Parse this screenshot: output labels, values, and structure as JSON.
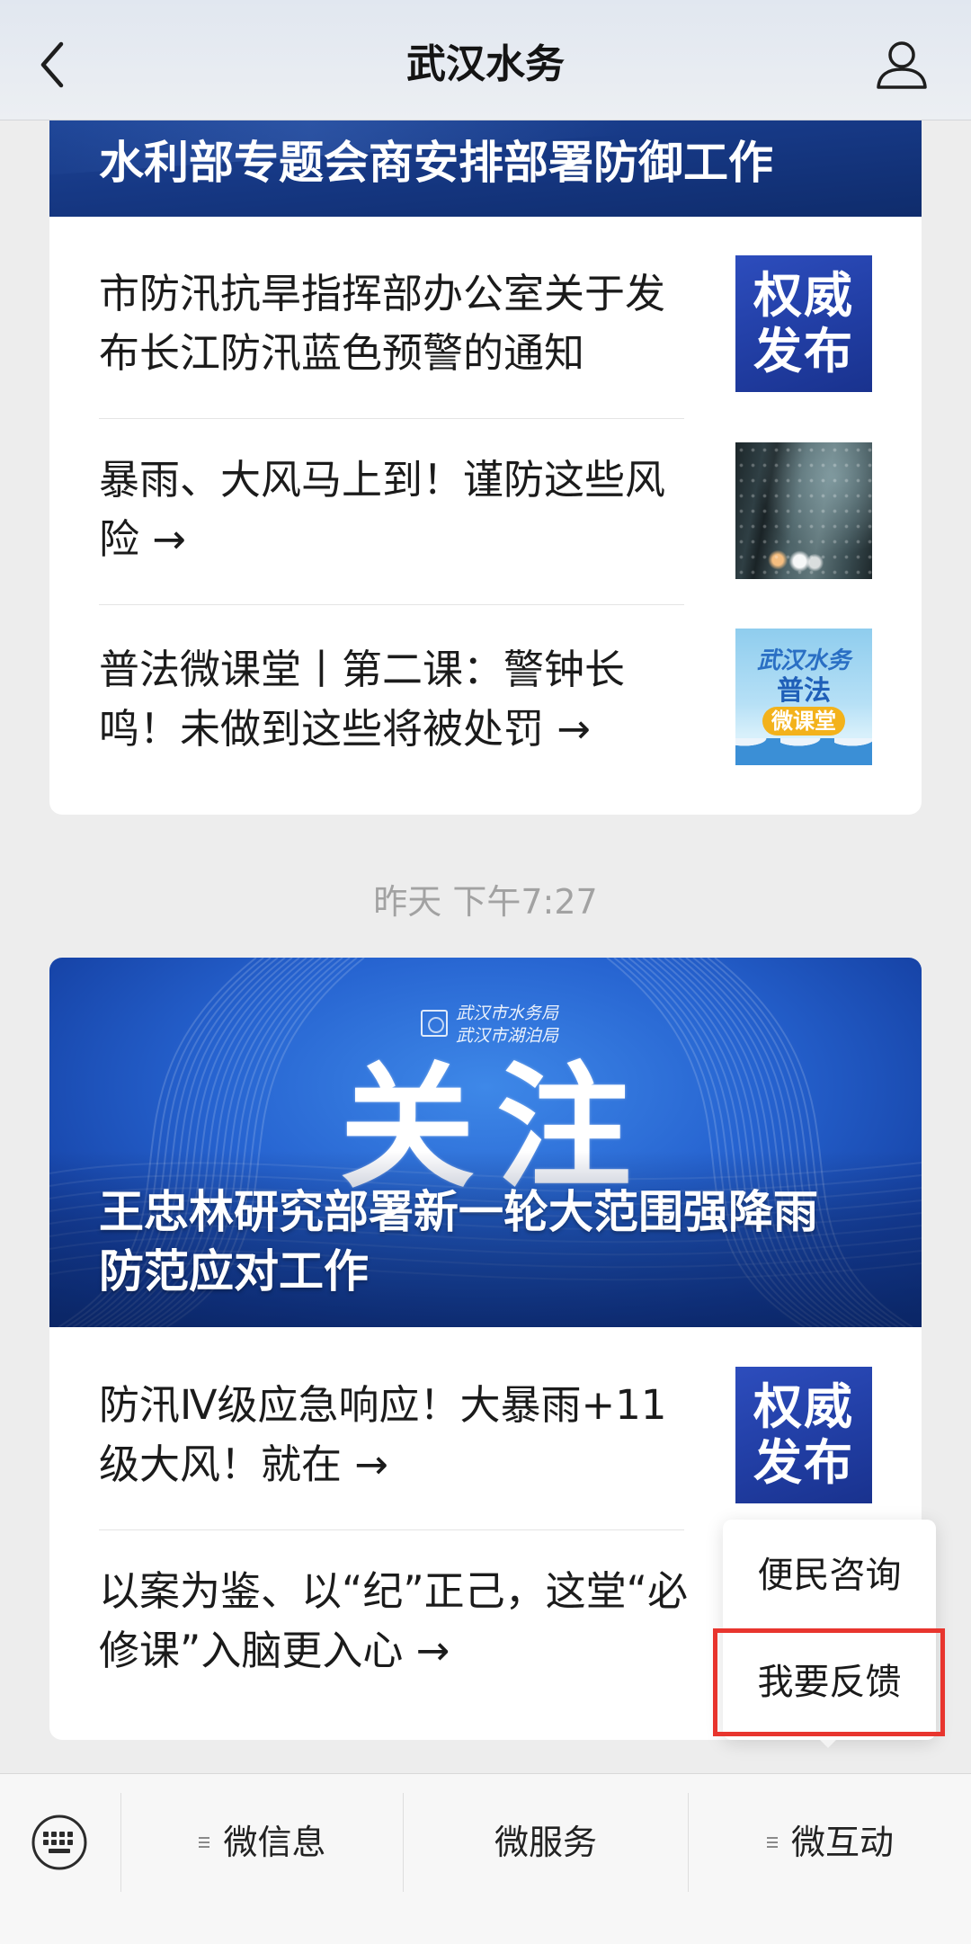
{
  "header": {
    "title": "武汉水务",
    "back_icon": "chevron-left-icon",
    "profile_icon": "user-icon"
  },
  "feed": {
    "groups": [
      {
        "banner": {
          "title": "水利部专题会商安排部署防御工作"
        },
        "articles": [
          {
            "title": "市防汛抗旱指挥部办公室关于发布长江防汛蓝色预警的通知",
            "thumb": {
              "lines": [
                "权威",
                "发布"
              ]
            }
          },
          {
            "title": "暴雨、大风马上到！谨防这些风险 →"
          },
          {
            "title": "普法微课堂丨第二课：警钟长鸣！未做到这些将被处罚 →",
            "thumb": {
              "brand": "武汉水务",
              "headline": "普法",
              "tag": "微课堂"
            }
          }
        ]
      },
      {
        "timestamp": "昨天 下午7:27",
        "banner": {
          "org_lines": [
            "武汉市水务局",
            "武汉市湖泊局"
          ],
          "watermark": "关注",
          "title": "王忠林研究部署新一轮大范围强降雨防范应对工作"
        },
        "articles": [
          {
            "title": "防汛Ⅳ级应急响应！大暴雨+11级大风！就在 →",
            "thumb": {
              "lines": [
                "权威",
                "发布"
              ]
            }
          },
          {
            "title": "以案为鉴、以“纪”正己，这堂“必修课”入脑更入心 →"
          }
        ]
      }
    ]
  },
  "popup_menu": {
    "items": [
      {
        "label": "便民咨询",
        "highlighted": false
      },
      {
        "label": "我要反馈",
        "highlighted": true
      }
    ]
  },
  "tab_bar": {
    "keyboard_icon": "keyboard-icon",
    "submenu_icon": "menu-icon",
    "tabs": [
      {
        "label": "微信息",
        "has_submenu": true
      },
      {
        "label": "微服务",
        "has_submenu": false
      },
      {
        "label": "微互动",
        "has_submenu": true
      }
    ]
  },
  "colors": {
    "page_background": "#ededed",
    "badge_blue": "#223fa6",
    "highlight_border": "#e8352e"
  }
}
